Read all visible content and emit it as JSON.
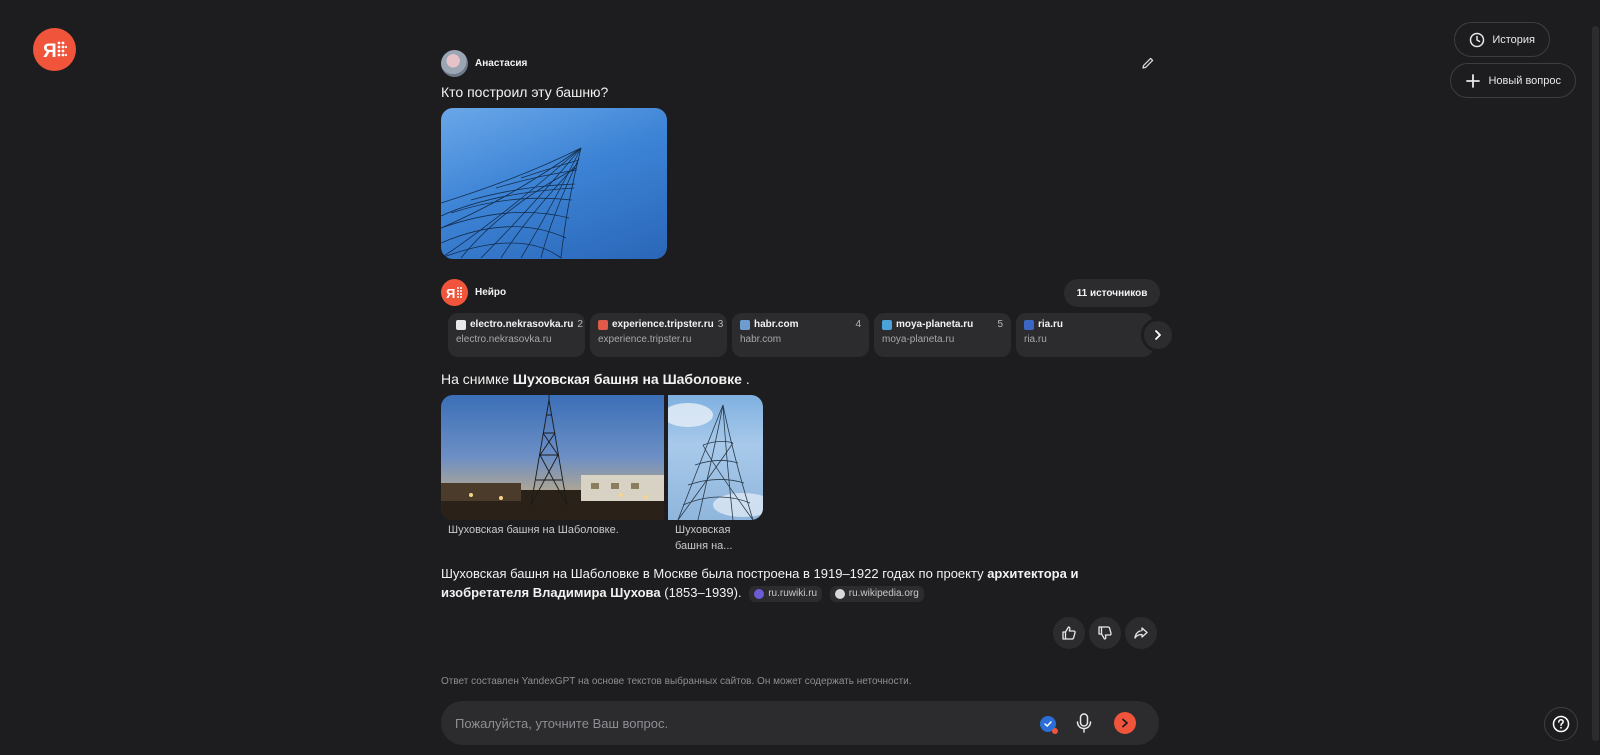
{
  "header": {
    "history_label": "История",
    "new_question_label": "Новый вопрос"
  },
  "user": {
    "name": "Анастасия",
    "question": "Кто построил эту башню?"
  },
  "assistant": {
    "name": "Нейро",
    "sources_count_label": "11 источников",
    "sources": [
      {
        "domain": "electro.nekrasovka.ru",
        "subtitle": "electro.nekrasovka.ru",
        "num": "2",
        "color": "#e8e8e8"
      },
      {
        "domain": "experience.tripster.ru",
        "subtitle": "experience.tripster.ru",
        "num": "3",
        "color": "#e05a4a"
      },
      {
        "domain": "habr.com",
        "subtitle": "habr.com",
        "num": "4",
        "color": "#6e9ccf"
      },
      {
        "domain": "moya-planeta.ru",
        "subtitle": "moya-planeta.ru",
        "num": "5",
        "color": "#4aa3d8"
      },
      {
        "domain": "ria.ru",
        "subtitle": "ria.ru",
        "num": "",
        "color": "#3b66c4"
      }
    ],
    "intro_prefix": "На снимке ",
    "intro_bold": "Шуховская башня на Шаболовке",
    "intro_suffix": " .",
    "photo_captions": [
      "Шуховская башня на Шаболовке.",
      "Шуховская башня на..."
    ],
    "answer_plain": "Шуховская башня на Шаболовке в Москве была построена в 1919–1922 годах по проекту ",
    "answer_bold": "архитектора и изобретателя Владимира Шухова",
    "answer_tail": " (1853–1939).",
    "citations": [
      {
        "label": "ru.ruwiki.ru",
        "color": "#6b5bd6"
      },
      {
        "label": "ru.wikipedia.org",
        "color": "#d8d8d8"
      }
    ]
  },
  "disclaimer": "Ответ составлен YandexGPT на основе текстов выбранных сайтов. Он может содержать неточности.",
  "input": {
    "placeholder": "Пожалуйста, уточните Ваш вопрос."
  },
  "colors": {
    "background": "#1d1d1f",
    "accent": "#f0543a",
    "card": "#2c2c2f"
  }
}
